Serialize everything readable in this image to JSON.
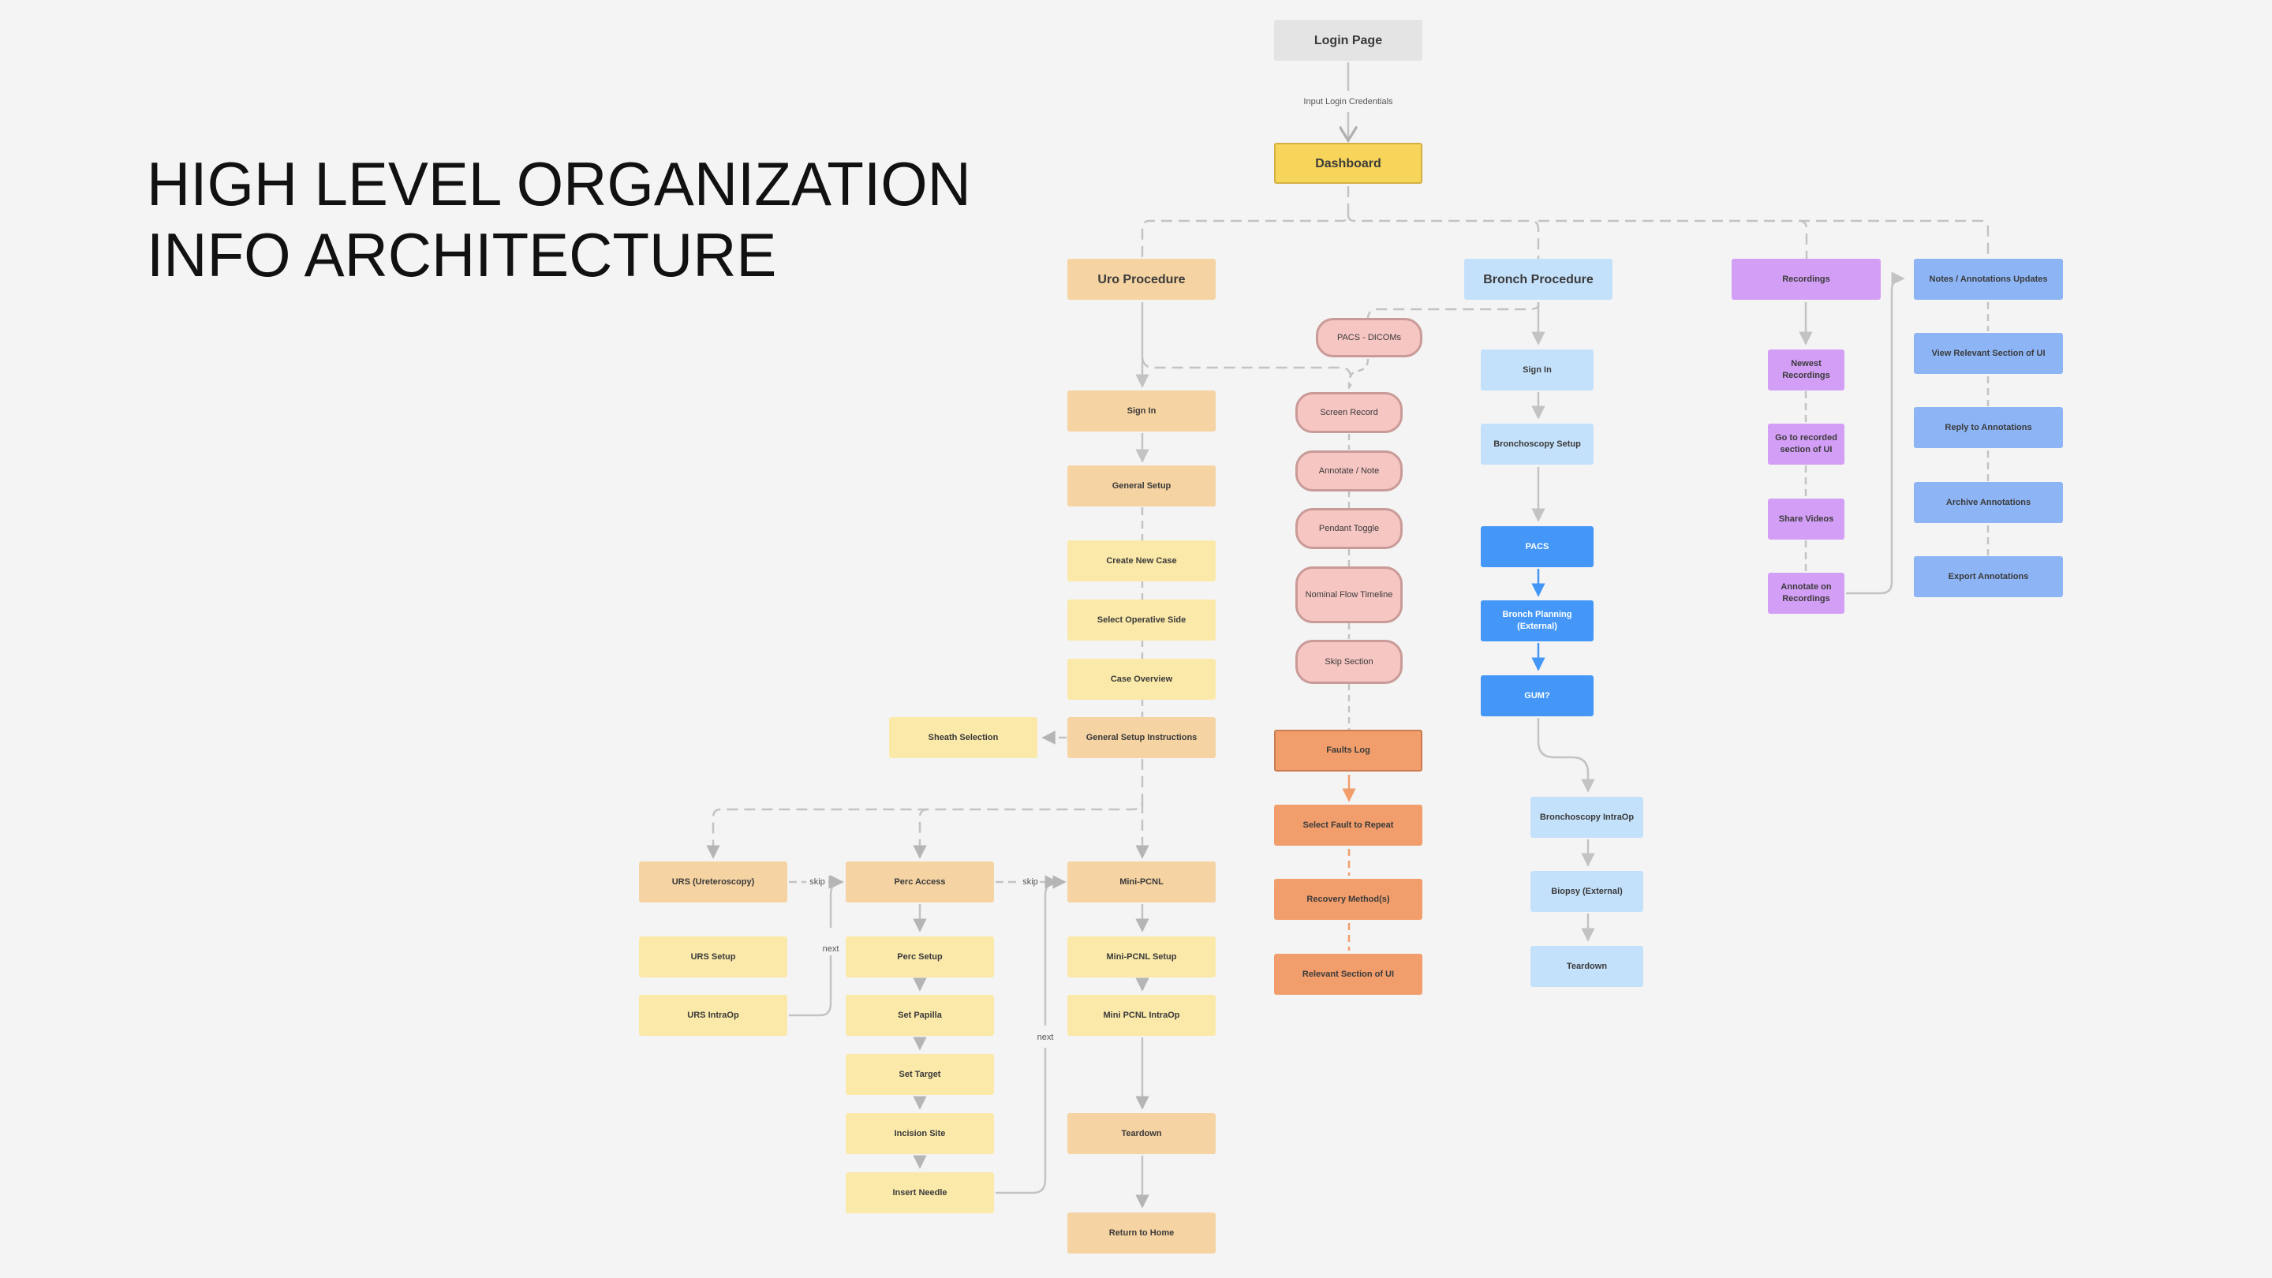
{
  "title": {
    "line1": "HIGH LEVEL ORGANIZATION",
    "line2": "INFO ARCHITECTURE"
  },
  "colors": {
    "background": "#f4f4f4",
    "login": "#e4e4e4",
    "dashboard": "#f7d45a",
    "uro_primary": "#f5d3a2",
    "uro_step": "#fbe9a9",
    "pill": "#f6c6c3",
    "fault": "#f19e6c",
    "bronch_light": "#c4e1fb",
    "bronch_dark": "#4597f7",
    "recordings": "#d39ef5",
    "notes": "#8db5f6",
    "connector": "#c3c3c3"
  },
  "nodes": {
    "login": "Login Page",
    "dashboard": "Dashboard",
    "uro": "Uro Procedure",
    "bronch": "Bronch Procedure",
    "recordings": "Recordings",
    "notes": "Notes / Annotations Updates",
    "uro_signin": "Sign In",
    "uro_general_setup": "General Setup",
    "create_new_case": "Create New Case",
    "select_operative_side": "Select Operative Side",
    "case_overview": "Case Overview",
    "general_setup_instructions": "General Setup Instructions",
    "sheath_selection": "Sheath Selection",
    "urs": "URS (Ureteroscopy)",
    "urs_setup": "URS Setup",
    "urs_intraop": "URS IntraOp",
    "perc_access": "Perc Access",
    "perc_setup": "Perc Setup",
    "set_papilla": "Set Papilla",
    "set_target": "Set Target",
    "incision_site": "Incision Site",
    "insert_needle": "Insert Needle",
    "mini_pcnl": "Mini-PCNL",
    "mini_pcnl_setup": "Mini-PCNL Setup",
    "mini_pcnl_intraop": "Mini PCNL IntraOp",
    "uro_teardown": "Teardown",
    "return_home": "Return to Home",
    "pacs_dicoms": "PACS - DICOMs",
    "screen_record": "Screen Record",
    "annotate_note": "Annotate / Note",
    "pendant_toggle": "Pendant Toggle",
    "nominal_flow": "Nominal Flow Timeline",
    "skip_section": "Skip Section",
    "faults_log": "Faults Log",
    "select_fault": "Select Fault to Repeat",
    "recovery_methods": "Recovery Method(s)",
    "relevant_section": "Relevant Section of UI",
    "bronch_signin": "Sign In",
    "bronch_setup": "Bronchoscopy Setup",
    "pacs": "PACS",
    "bronch_planning": "Bronch Planning (External)",
    "gum": "GUM?",
    "bronch_intraop": "Bronchoscopy IntraOp",
    "biopsy": "Biopsy (External)",
    "bronch_teardown": "Teardown",
    "newest_recordings": "Newest Recordings",
    "goto_recorded": "Go to recorded section of UI",
    "share_videos": "Share Videos",
    "annotate_recordings": "Annotate on Recordings",
    "view_relevant": "View Relevant Section of UI",
    "reply_annotations": "Reply to Annotations",
    "archive_annotations": "Archive Annotations",
    "export_annotations": "Export Annotations"
  },
  "edge_labels": {
    "login_to_dashboard": "Input Login Credentials",
    "skip1": "skip",
    "skip2": "skip",
    "next1": "next",
    "next2": "next"
  }
}
